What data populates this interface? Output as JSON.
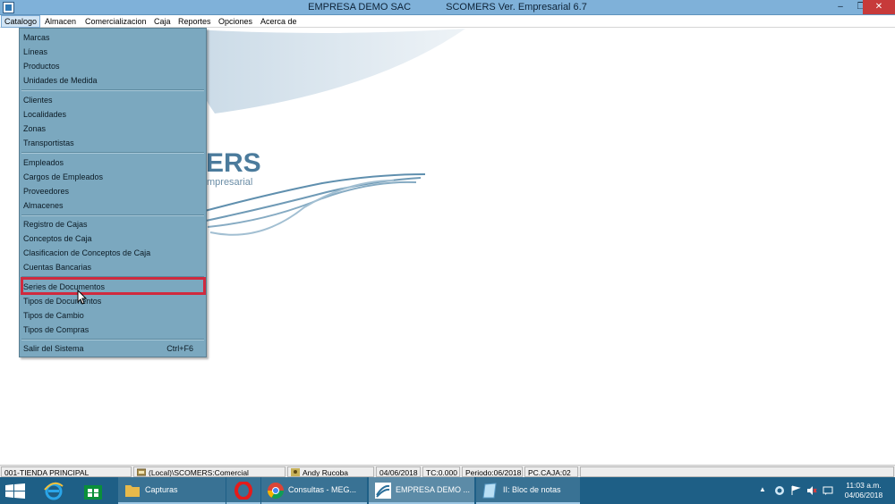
{
  "window": {
    "title_company": "EMPRESA DEMO SAC",
    "title_app": "SCOMERS Ver. Empresarial  6.7",
    "minimize_label": "–",
    "maximize_label": "❐",
    "close_label": "✕"
  },
  "menubar": {
    "items": [
      "Catalogo",
      "Almacen",
      "Comercializacion",
      "Caja",
      "Reportes",
      "Opciones",
      "Acerca de"
    ],
    "active_index": 0
  },
  "logo": {
    "text_main": "ERS",
    "text_sub": "mpresarial"
  },
  "dropdown": {
    "groups": [
      [
        "Marcas",
        "Líneas",
        "Productos",
        "Unidades de Medida"
      ],
      [
        "Clientes",
        "Localidades",
        "Zonas",
        "Transportistas"
      ],
      [
        "Empleados",
        "Cargos de Empleados",
        "Proveedores",
        "Almacenes"
      ],
      [
        "Registro de Cajas",
        "Conceptos de Caja",
        "Clasificacion de Conceptos de Caja",
        "Cuentas Bancarias"
      ],
      [
        "Series de Documentos",
        "Tipos de Documentos",
        "Tipos de Cambio",
        "Tipos de Compras"
      ]
    ],
    "exit_label": "Salir del Sistema",
    "exit_shortcut": "Ctrl+F6",
    "highlighted_item": "Series de Documentos"
  },
  "statusbar": {
    "store": "001-TIENDA PRINCIPAL",
    "database": "(Local)\\SCOMERS:Comercial",
    "user": "Andy Rucoba",
    "date": "04/06/2018",
    "exchange_rate": "TC:0.000",
    "period": "Periodo:06/2018",
    "terminal": "PC.CAJA:02"
  },
  "taskbar": {
    "apps": [
      {
        "label": "Capturas",
        "icon": "folder-icon"
      },
      {
        "label": "",
        "icon": "opera-icon"
      },
      {
        "label": "Consultas - MEG...",
        "icon": "chrome-icon"
      },
      {
        "label": "EMPRESA DEMO ...",
        "icon": "scomers-icon"
      },
      {
        "label": "II: Bloc de notas",
        "icon": "notepad-icon"
      }
    ],
    "clock_time": "11:03 a.m.",
    "clock_date": "04/06/2018",
    "tray_chevron": "▲"
  },
  "colors": {
    "titlebar": "#7fb1d9",
    "menu_bg": "#7ba8bf",
    "highlight": "#d02a3e",
    "taskbar": "#1e5f86"
  }
}
